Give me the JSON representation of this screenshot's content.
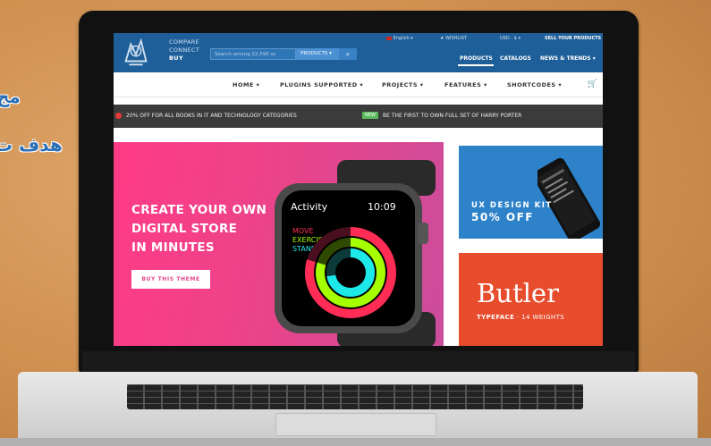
{
  "background_text": {
    "line1": "مج",
    "line2": "هدف ت"
  },
  "site": {
    "logo": {
      "line1": "COMPARE",
      "line2": "CONNECT",
      "line3": "BUY"
    },
    "search": {
      "placeholder": "Search among 22,590 ss",
      "category": "PRODUCTS",
      "icon": "search-icon"
    },
    "utility": {
      "language": "English",
      "wishlist": "WISHLIST",
      "currency": "USD - $",
      "sell": "SELL YOUR PRODUCTS"
    },
    "main_nav": [
      "PRODUCTS",
      "CATALOGS",
      "NEWS & TRENDS"
    ],
    "secondary_nav": [
      "HOME",
      "PLUGINS SUPPORTED",
      "PROJECTS",
      "FEATURES",
      "SHORTCODES"
    ],
    "cart_icon": "cart-icon",
    "promo": {
      "text1": "20% OFF FOR ALL BOOKS IN IT AND TECHNOLOGY CATEGORIES",
      "badge": "NEW",
      "text2": "BE THE FIRST TO OWN FULL SET OF HARRY PORTER"
    },
    "hero": {
      "line1": "CREATE YOUR OWN",
      "line2": "DIGITAL STORE",
      "line3": "IN MINUTES",
      "button": "BUY THIS THEME",
      "watch": {
        "app": "Activity",
        "time": "10:09",
        "move": "MOVE",
        "exercise": "EXERCISE",
        "stand": "STAND"
      }
    },
    "ux_tile": {
      "line1": "UX DESIGN KIT",
      "line2": "50% OFF"
    },
    "butler_tile": {
      "title": "Butler",
      "sub_bold": "TYPEFACE",
      "sub_rest": " · 14 WEIGHTS"
    }
  },
  "colors": {
    "topbar": "#1f5f99",
    "hero_pink": "#e9448a",
    "ux_blue": "#2e82c9",
    "butler_red": "#e74c2c",
    "promo_bar": "#3b3b3b"
  }
}
